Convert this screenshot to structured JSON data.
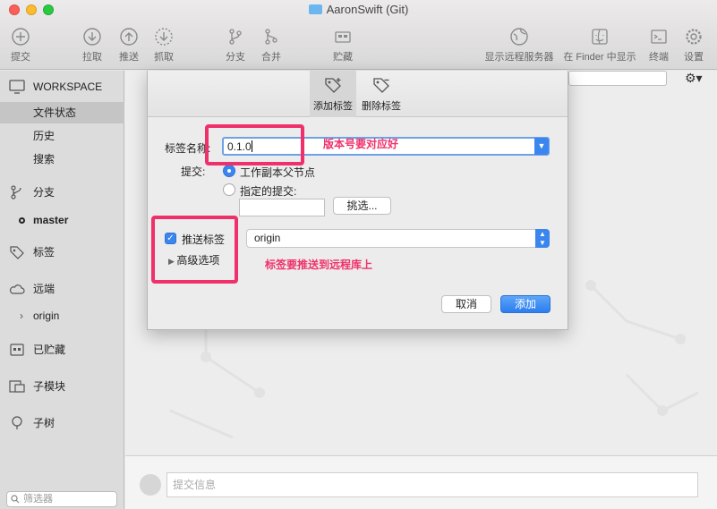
{
  "window": {
    "title": "AaronSwift (Git)"
  },
  "toolbar": {
    "commit": "提交",
    "pull": "拉取",
    "push": "推送",
    "fetch": "抓取",
    "branch": "分支",
    "merge": "合并",
    "stash": "贮藏",
    "show_remote": "显示远程服务器",
    "show_in_finder": "在 Finder 中显示",
    "terminal": "终端",
    "settings": "设置"
  },
  "sidebar": {
    "workspace": "WORKSPACE",
    "file_status": "文件状态",
    "history": "历史",
    "search": "搜索",
    "branches": "分支",
    "master": "master",
    "tags": "标签",
    "remotes": "远端",
    "origin": "origin",
    "stashes": "已贮藏",
    "submodules": "子模块",
    "subtrees": "子树",
    "filter_placeholder": "筛选器"
  },
  "main": {
    "commit_placeholder": "提交信息"
  },
  "dialog": {
    "tab_add_tag": "添加标签",
    "tab_remove_tag": "删除标签",
    "tag_name_label": "标签名称:",
    "tag_name_value": "0.1.0",
    "commit_label": "提交:",
    "radio_working_copy": "工作副本父节点",
    "radio_specified_commit": "指定的提交:",
    "pick_button": "挑选...",
    "push_tag_label": "推送标签",
    "push_tag_checked": true,
    "remote_value": "origin",
    "advanced_options": "高级选项",
    "cancel_button": "取消",
    "add_button": "添加"
  },
  "annotations": {
    "version_note": "版本号要对应好",
    "push_note": "标签要推送到远程库上",
    "highlight_color": "#f0306a"
  },
  "colors": {
    "accent": "#3b86ee"
  }
}
